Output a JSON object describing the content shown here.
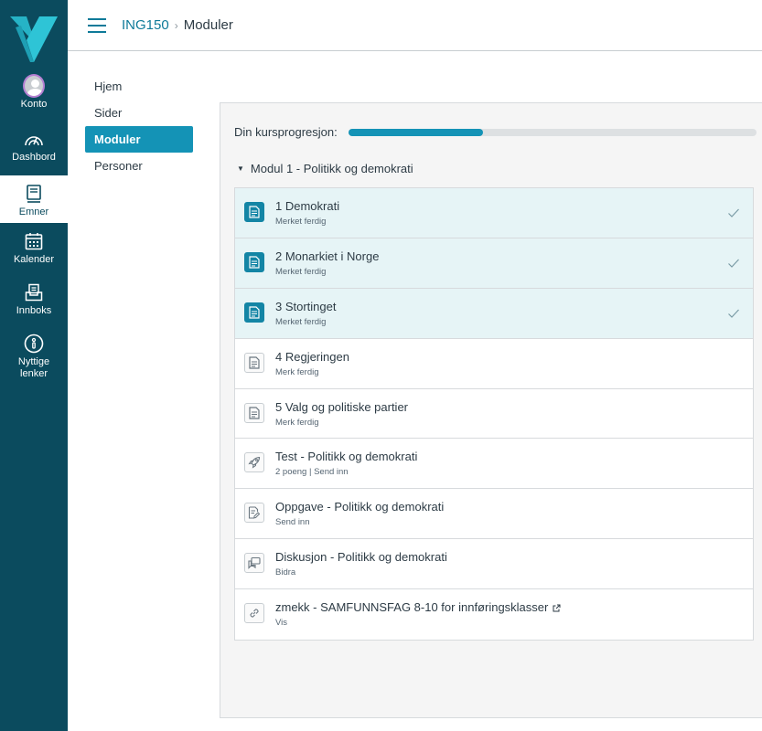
{
  "colors": {
    "nav_bg": "#0b4b5e",
    "accent": "#1493b6",
    "link": "#0e7a99",
    "completed_row": "#e6f4f6"
  },
  "global_nav": {
    "items": [
      {
        "label": "Konto",
        "icon": "avatar"
      },
      {
        "label": "Dashbord",
        "icon": "speedometer-icon"
      },
      {
        "label": "Emner",
        "icon": "book-icon",
        "active": true
      },
      {
        "label": "Kalender",
        "icon": "calendar-icon"
      },
      {
        "label": "Innboks",
        "icon": "inbox-icon"
      },
      {
        "label": "Nyttige lenker",
        "icon": "info-icon"
      }
    ]
  },
  "header": {
    "course": "ING150",
    "separator": "›",
    "current": "Moduler"
  },
  "course_nav": {
    "items": [
      {
        "label": "Hjem"
      },
      {
        "label": "Sider"
      },
      {
        "label": "Moduler",
        "active": true
      },
      {
        "label": "Personer"
      }
    ]
  },
  "progress": {
    "label": "Din kursprogresjon:",
    "percent": 33
  },
  "module": {
    "caret": "▼",
    "title": "Modul 1 - Politikk og demokrati",
    "items": [
      {
        "title": "1 Demokrati",
        "sub": "Merket ferdig",
        "type": "page",
        "icon": "page-icon",
        "done": true
      },
      {
        "title": "2 Monarkiet i Norge",
        "sub": "Merket ferdig",
        "type": "page",
        "icon": "page-icon",
        "done": true
      },
      {
        "title": "3 Stortinget",
        "sub": "Merket ferdig",
        "type": "page",
        "icon": "page-icon",
        "done": true
      },
      {
        "title": "4 Regjeringen",
        "sub": "Merk ferdig",
        "type": "page",
        "icon": "page-icon",
        "done": false
      },
      {
        "title": "5 Valg og politiske partier",
        "sub": "Merk ferdig",
        "type": "page",
        "icon": "page-icon",
        "done": false
      },
      {
        "title": "Test - Politikk og demokrati",
        "sub": "2 poeng  |  Send inn",
        "type": "quiz",
        "icon": "rocket-icon",
        "done": false
      },
      {
        "title": "Oppgave - Politikk og demokrati",
        "sub": "Send inn",
        "type": "assignment",
        "icon": "assignment-icon",
        "done": false
      },
      {
        "title": "Diskusjon - Politikk og demokrati",
        "sub": "Bidra",
        "type": "discussion",
        "icon": "discussion-icon",
        "done": false
      },
      {
        "title": "zmekk - SAMFUNNSFAG 8-10 for innføringsklasser",
        "sub": "Vis",
        "type": "link",
        "icon": "link-icon",
        "done": false,
        "external": true
      }
    ]
  }
}
